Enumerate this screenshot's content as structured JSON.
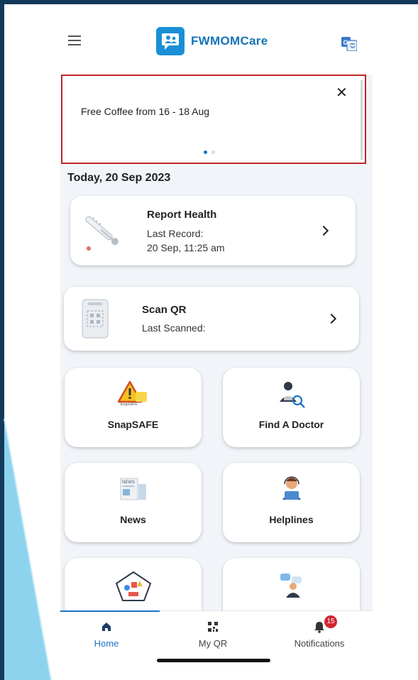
{
  "app": {
    "name": "FWMOMCare"
  },
  "banner": {
    "text": "Free Coffee from 16 - 18 Aug",
    "close_symbol": "✕",
    "page_count": 2,
    "active_page": 1
  },
  "date_heading": "Today, 20 Sep 2023",
  "report_health": {
    "title": "Report Health",
    "last_record_label": "Last Record:",
    "last_record_value": "20 Sep, 11:25 am"
  },
  "scan_qr": {
    "title": "Scan QR",
    "last_scanned_label": "Last Scanned:"
  },
  "tiles": [
    {
      "label": "SnapSAFE",
      "icon": "warning-icon"
    },
    {
      "label": "Find A Doctor",
      "icon": "doctor-search-icon"
    },
    {
      "label": "News",
      "icon": "news-icon"
    },
    {
      "label": "Helplines",
      "icon": "helpline-icon"
    },
    {
      "label": "",
      "icon": "wellness-icon"
    },
    {
      "label": "",
      "icon": "talk-icon"
    }
  ],
  "bottom_nav": [
    {
      "label": "Home",
      "icon": "home-icon",
      "active": true
    },
    {
      "label": "My QR",
      "icon": "qr-icon",
      "active": false
    },
    {
      "label": "Notifications",
      "icon": "bell-icon",
      "active": false,
      "badge": "15"
    }
  ],
  "colors": {
    "brand": "#1573b8",
    "accent": "#1b74c4",
    "highlight_border": "#c0262c",
    "badge": "#d32431",
    "frame": "#14395a",
    "deco": "#8ed3ee"
  }
}
